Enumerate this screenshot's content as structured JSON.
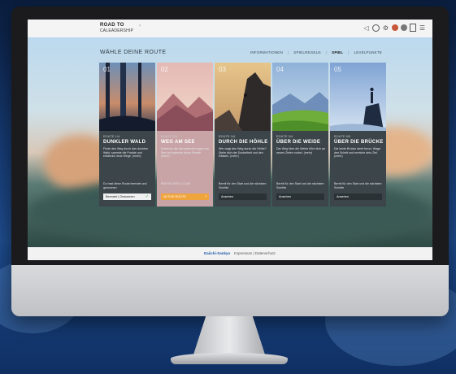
{
  "header": {
    "logo_line1": "ROAD TO",
    "logo_line2": "CALEADERSHIP",
    "icons": [
      "back-arrow-icon",
      "clock-icon",
      "gear-icon",
      "avatar-icon",
      "badge-icon",
      "info-icon",
      "menu-icon"
    ]
  },
  "page_title": "WÄHLE DEINE ROUTE",
  "nav": {
    "items": [
      "INFORMATIONEN",
      "SPIELREGELN",
      "SPIEL",
      "LEVELPUNKTE"
    ],
    "separator": "|",
    "active_index": 2
  },
  "cards": [
    {
      "number": "01",
      "kicker": "ROUTE 1/4",
      "title": "DUNKLER WALD",
      "description": "Finde den Weg durch den dunklen Wald, sammle die Punkte und entdecke neue Wege. (mehr)",
      "meta": "Du hast diese Route beendet und gewonnen",
      "button": "Beendet | Gewonnen",
      "button_style": "light",
      "completed": true
    },
    {
      "number": "02",
      "kicker": "ROUTE 2/4",
      "title": "WEG AM SEE",
      "description": "Entdecke die Herausforderungen am See und sammle deine Punkte. (mehr)",
      "meta": "ROUTE AKTIV | 12:00",
      "button": "AKTIVE ROUTE",
      "button_style": "orange",
      "completed": false
    },
    {
      "number": "03",
      "kicker": "ROUTE 3/4",
      "title": "DURCH DIE HÖHLE",
      "description": "Wer wagt den Weg durch die Höhle? Stelle dich der Dunkelheit und den Rätseln. (mehr)",
      "meta": "Bereit für den Start und die nächsten Schritte",
      "button": "Ansehen",
      "button_style": "dark",
      "completed": false
    },
    {
      "number": "04",
      "kicker": "ROUTE 3/4",
      "title": "ÜBER DIE WEIDE",
      "description": "Der Weg über die Weide führt dich an neuen Zielen vorbei. (mehr)",
      "meta": "Bereit für den Start und die nächsten Schritte",
      "button": "Ansehen",
      "button_style": "dark",
      "completed": false
    },
    {
      "number": "05",
      "kicker": "ROUTE 5/5",
      "title": "ÜBER DIE BRÜCKE",
      "description": "Die letzte Brücke steht bevor. Wage den Schritt und erreiche dein Ziel. (mehr)",
      "meta": "Bereit für den Start und die nächsten Schritte",
      "button": "Ansehen",
      "button_style": "dark",
      "completed": false
    }
  ],
  "footer": {
    "brand": "Daiichi-Sankyo",
    "links": "Impressum | Datenschutz"
  },
  "colors": {
    "accent_orange": "#f0a43c",
    "card_dark": "#3c4549",
    "card_pink": "#c9a4a6"
  }
}
